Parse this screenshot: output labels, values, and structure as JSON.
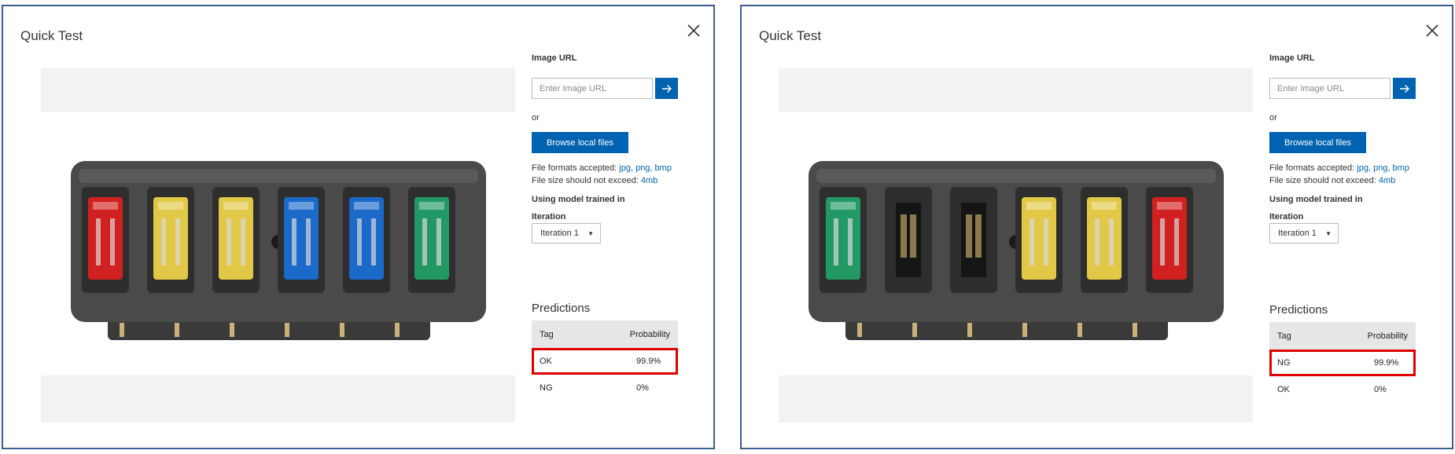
{
  "panels": [
    {
      "title": "Quick Test",
      "image_url_label": "Image URL",
      "image_url_placeholder": "Enter Image URL",
      "or": "or",
      "browse_label": "Browse local files",
      "formats_prefix": "File formats accepted:",
      "formats": "jpg, png, bmp",
      "size_prefix": "File size should not exceed:",
      "size": "4mb",
      "model_label": "Using model trained in",
      "iteration_label": "Iteration",
      "iteration_value": "Iteration 1",
      "predictions_title": "Predictions",
      "columns": [
        "Tag",
        "Probability"
      ],
      "rows": [
        {
          "tag": "OK",
          "probability": "99.9%"
        },
        {
          "tag": "NG",
          "probability": "0%"
        }
      ],
      "fuses": [
        "red",
        "yellow",
        "yellow",
        "blue",
        "blue",
        "green"
      ]
    },
    {
      "title": "Quick Test",
      "image_url_label": "Image URL",
      "image_url_placeholder": "Enter Image URL",
      "or": "or",
      "browse_label": "Browse local files",
      "formats_prefix": "File formats accepted:",
      "formats": "jpg, png, bmp",
      "size_prefix": "File size should not exceed:",
      "size": "4mb",
      "model_label": "Using model trained in",
      "iteration_label": "Iteration",
      "iteration_value": "Iteration 1",
      "predictions_title": "Predictions",
      "columns": [
        "Tag",
        "Probability"
      ],
      "rows": [
        {
          "tag": "NG",
          "probability": "99.9%"
        },
        {
          "tag": "OK",
          "probability": "0%"
        }
      ],
      "fuses": [
        "green",
        "empty",
        "empty",
        "yellow",
        "yellow",
        "red"
      ]
    }
  ],
  "colors": {
    "accent": "#0063b1",
    "highlight": "#e00000",
    "border": "#3a5f8f",
    "fuse_red": "#e02020",
    "fuse_yellow": "#f2d64a",
    "fuse_blue": "#1a6fd6",
    "fuse_green": "#22a36a"
  },
  "icons": {
    "close": "close-icon",
    "go": "arrow-right-icon",
    "dropdown": "chevron-down-icon"
  }
}
